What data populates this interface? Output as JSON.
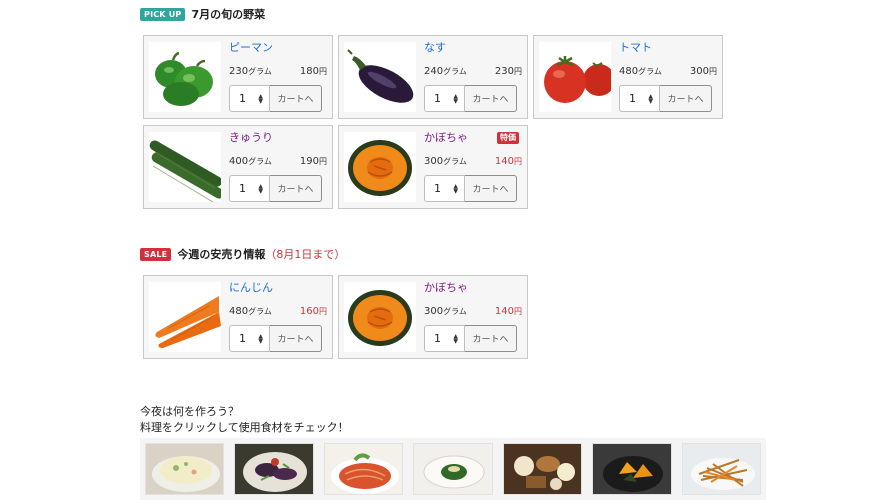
{
  "pickup": {
    "badge": "PICK UP",
    "badge_color": "#2fa59d",
    "title": "7月の旬の野菜",
    "items": [
      {
        "name": "ピーマン",
        "weight": "230",
        "unit": "グラム",
        "price": "180",
        "yen": "円",
        "qty": "1",
        "cart": "カートへ",
        "image": "green-pepper"
      },
      {
        "name": "なす",
        "weight": "240",
        "unit": "グラム",
        "price": "230",
        "yen": "円",
        "qty": "1",
        "cart": "カートへ",
        "image": "eggplant"
      },
      {
        "name": "トマト",
        "weight": "480",
        "unit": "グラム",
        "price": "300",
        "yen": "円",
        "qty": "1",
        "cart": "カートへ",
        "image": "tomato"
      },
      {
        "name": "きゅうり",
        "weight": "400",
        "unit": "グラム",
        "price": "190",
        "yen": "円",
        "qty": "1",
        "cart": "カートへ",
        "image": "cucumber"
      },
      {
        "name": "かぼちゃ",
        "weight": "300",
        "unit": "グラム",
        "price": "140",
        "yen": "円",
        "qty": "1",
        "cart": "カートへ",
        "image": "pumpkin",
        "tag": "特価"
      }
    ]
  },
  "sale": {
    "badge": "SALE",
    "badge_color": "#d0323c",
    "title": "今週の安売り情報",
    "note": "（8月1日まで）",
    "items": [
      {
        "name": "にんじん",
        "weight": "480",
        "unit": "グラム",
        "price": "160",
        "yen": "円",
        "qty": "1",
        "cart": "カートへ",
        "image": "carrot"
      },
      {
        "name": "かぼちゃ",
        "weight": "300",
        "unit": "グラム",
        "price": "140",
        "yen": "円",
        "qty": "1",
        "cart": "カートへ",
        "image": "pumpkin"
      }
    ]
  },
  "recipes": {
    "line1": "今夜は何を作ろう？",
    "line2": "料理をクリックして使用食材をチェック！",
    "items": [
      "potato-salad",
      "eggplant-dish",
      "tomato-pasta",
      "spinach-side",
      "oden",
      "simmered-pumpkin",
      "kinpira"
    ]
  },
  "colors": {
    "link": "#1a6fd8",
    "visited": "#7b1d7e",
    "sale_price": "#d0323c"
  }
}
